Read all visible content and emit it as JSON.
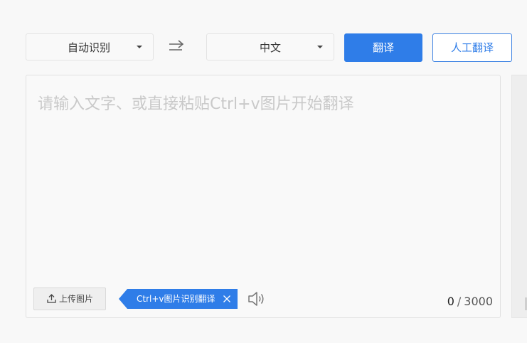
{
  "toolbar": {
    "source_language": "自动识别",
    "target_language": "中文",
    "translate_label": "翻译",
    "human_translate_label": "人工翻译"
  },
  "input": {
    "placeholder": "请输入文字、或直接粘贴Ctrl+v图片开始翻译",
    "value": "",
    "upload_label": "上传图片",
    "ocr_tag_label": "Ctrl+v图片识别翻译",
    "char_count": "0",
    "char_separator": "/",
    "char_limit": "3000"
  },
  "colors": {
    "accent": "#2f7de8",
    "background": "#f8f8f8",
    "panel": "#f9f9f9",
    "placeholder": "#c9c9c9"
  },
  "icons": {
    "caret": "chevron-down-icon",
    "swap": "swap-arrow-icon",
    "upload": "upload-icon",
    "close": "close-icon",
    "speaker": "speaker-icon"
  }
}
